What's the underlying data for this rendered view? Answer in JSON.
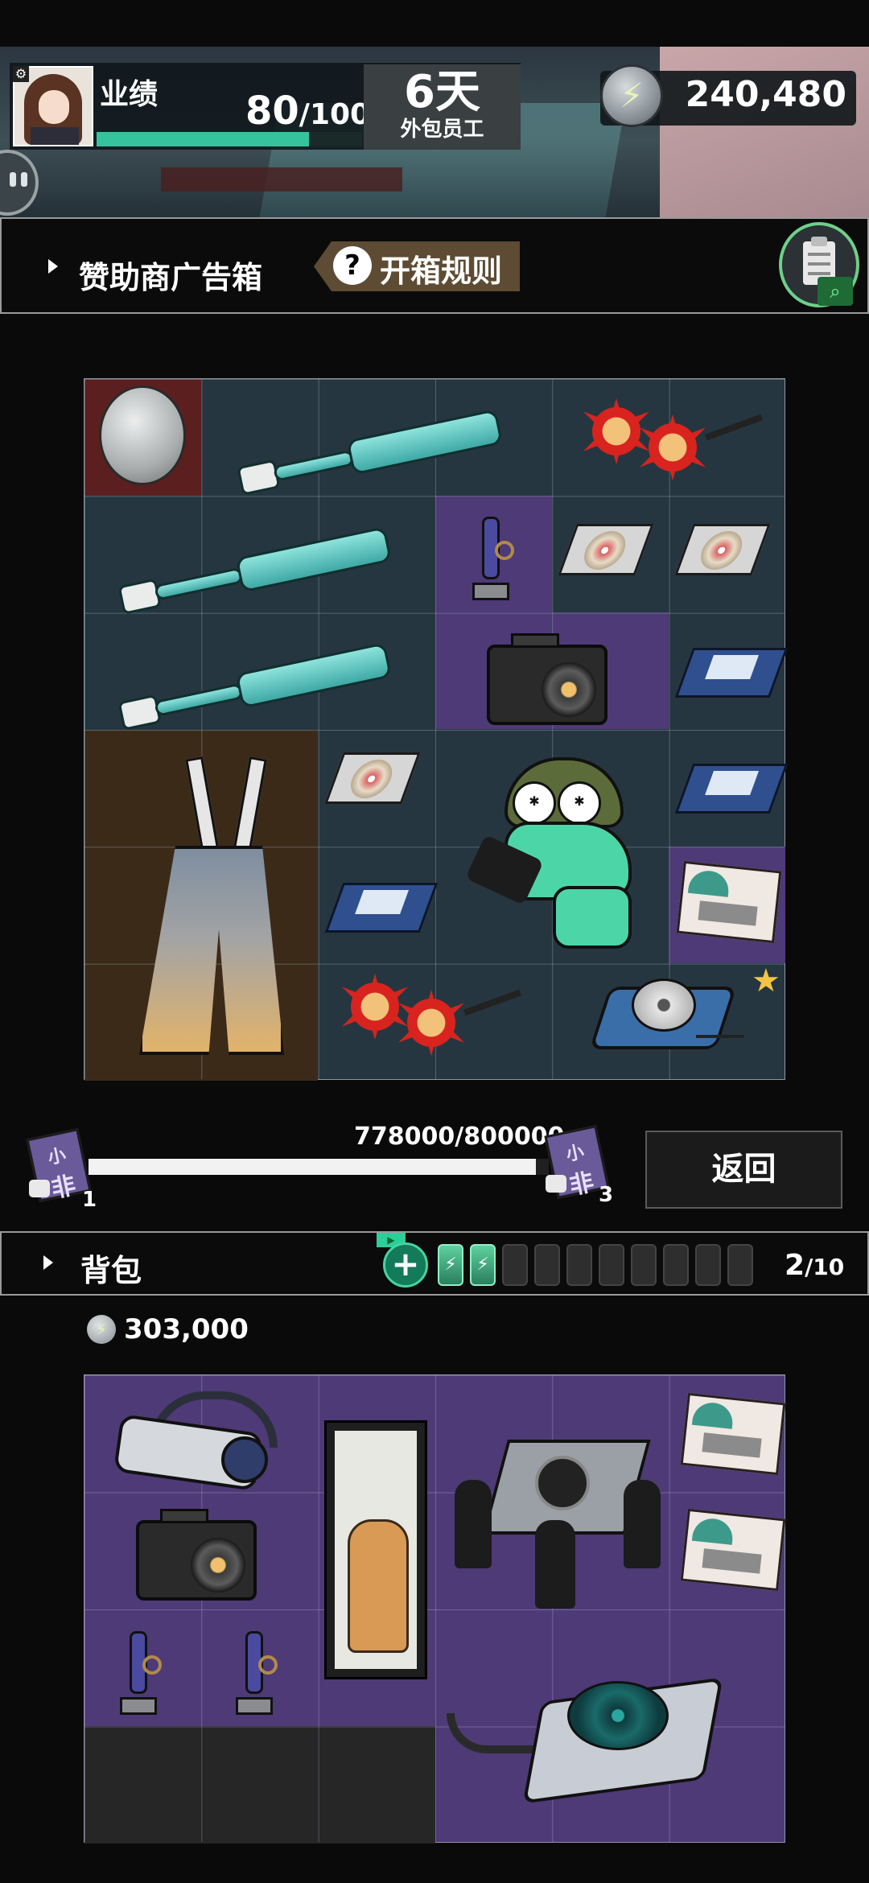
{
  "hud": {
    "performance_label": "业绩",
    "performance_value": "80",
    "performance_max": "/100",
    "performance_fraction": 0.8,
    "days_value": "6天",
    "days_label": "外包员工",
    "coins": "240,480"
  },
  "sponsor_section": {
    "title": "赞助商广告箱",
    "rules_button": "开箱规则",
    "rules_icon": "question-icon",
    "clipboard_icon": "clipboard-search-icon"
  },
  "sponsor_grid": {
    "columns": 6,
    "rows": 6,
    "items": [
      {
        "name": "silver-coin",
        "rarity_color": "#5b1f1f"
      },
      {
        "name": "toothbrush"
      },
      {
        "name": "toothbrush"
      },
      {
        "name": "toothbrush"
      },
      {
        "name": "sun-flail"
      },
      {
        "name": "sun-flail"
      },
      {
        "name": "sword-figure",
        "rarity_color": "#4e3a76"
      },
      {
        "name": "cd-disc"
      },
      {
        "name": "cd-disc"
      },
      {
        "name": "cd-disc"
      },
      {
        "name": "camera",
        "rarity_color": "#4e3a76"
      },
      {
        "name": "floppy-disk"
      },
      {
        "name": "floppy-disk"
      },
      {
        "name": "floppy-disk"
      },
      {
        "name": "overalls",
        "rarity_color": "#3c2a18"
      },
      {
        "name": "frog-character"
      },
      {
        "name": "postcard",
        "rarity_color": "#4e3a76"
      },
      {
        "name": "cd-player"
      }
    ]
  },
  "progress": {
    "text": "778000/800000",
    "fraction": 0.9725,
    "left_ticket_count": "1",
    "right_ticket_count": "3",
    "ticket_label_top": "小",
    "ticket_label_bottom": "非"
  },
  "back_button": "返回",
  "backpack": {
    "title": "背包",
    "slots_used": "2",
    "slots_total": "/10",
    "coin_value": "303,000",
    "battery_icon": "battery-icon",
    "items": [
      {
        "name": "vr-headset"
      },
      {
        "name": "tiger-scroll"
      },
      {
        "name": "coffin-dancers"
      },
      {
        "name": "postcard"
      },
      {
        "name": "camera"
      },
      {
        "name": "postcard"
      },
      {
        "name": "sword-figure"
      },
      {
        "name": "sword-figure"
      },
      {
        "name": "radar-device"
      }
    ]
  },
  "colors": {
    "accent_green": "#35c29d",
    "sponsor_grid_bg": "#263640",
    "backpack_grid_bg": "#4e3a76",
    "rules_button_bg": "#5e4b33"
  }
}
